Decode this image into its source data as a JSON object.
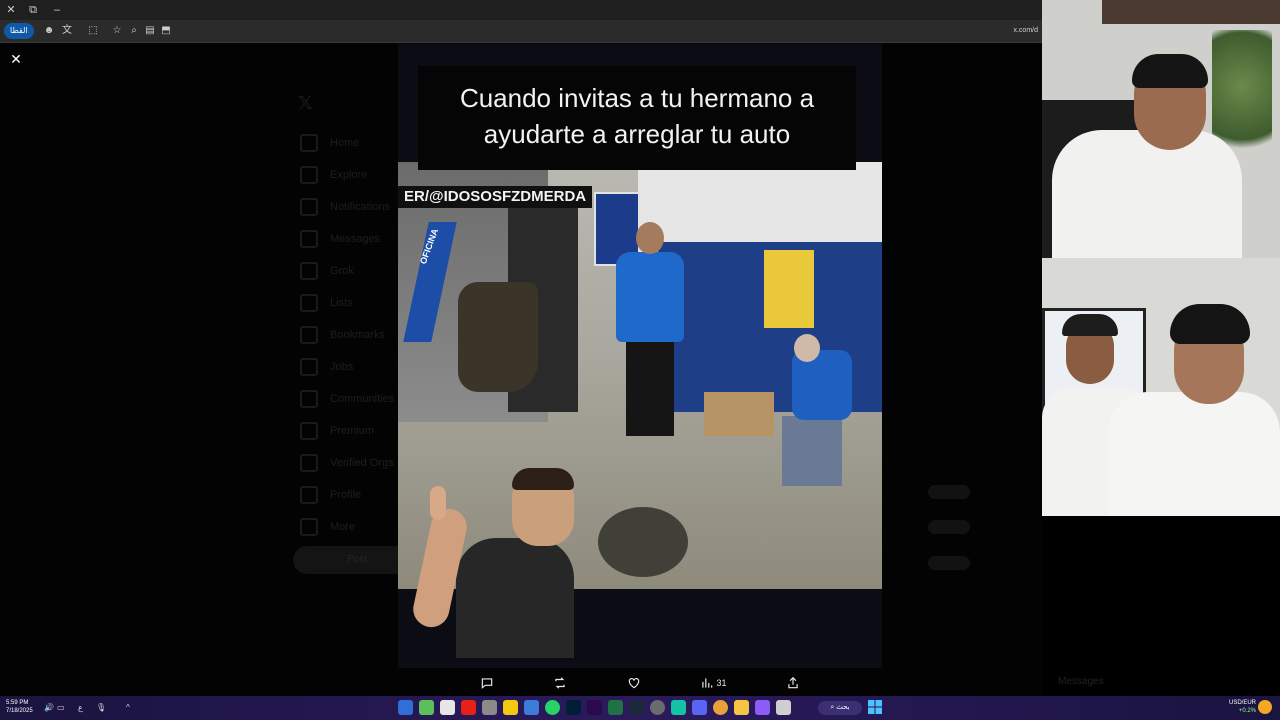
{
  "browser": {
    "url_fragment": "x.com/d",
    "tab_group_label": "القطا"
  },
  "x_page": {
    "nav": [
      "Home",
      "Explore",
      "Notifications",
      "Messages",
      "Grok",
      "Lists",
      "Bookmarks",
      "Jobs",
      "Communities",
      "Premium",
      "Verified Orgs",
      "Profile",
      "More"
    ],
    "post_label": "Post",
    "messages_label": "Messages"
  },
  "video": {
    "caption_line1": "Cuando invitas a tu hermano a",
    "caption_line2": "ayudarte a arreglar tu auto",
    "watermark": "ER/@IDOSOSFZDMERDA",
    "banner_text": "OFICINA"
  },
  "actions": {
    "views_count": "31"
  },
  "taskbar": {
    "time": "5:59 PM",
    "date": "7/18/2025",
    "lang": "ع",
    "search_label": "بحث",
    "currency": "USD/EUR",
    "currency_value": "+0.2%"
  },
  "colors": {
    "accent": "#1d9bf0",
    "taskbar": "#2a1a5c",
    "background": "#000000"
  }
}
